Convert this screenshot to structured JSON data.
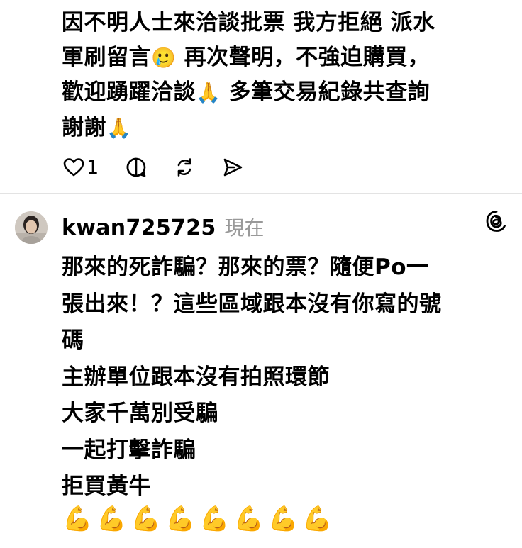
{
  "post": {
    "lines": [
      "因不明人士來洽談批票 我方拒絕 派水",
      "軍刷留言",
      "再次聲明，不強迫購買，",
      "歡迎踴躍洽談",
      "多筆交易紀錄共查詢",
      "謝謝"
    ],
    "emoji_tear_smile": "🥲",
    "emoji_pray": "🙏"
  },
  "actions": {
    "like_count": "1",
    "icons": [
      "heart-icon",
      "comment-icon",
      "repost-icon",
      "share-icon"
    ]
  },
  "reply": {
    "username": "kwan725725",
    "time": "現在",
    "lines": [
      "那來的死詐騙？那來的票？隨便Po一",
      "張出來！？這些區域跟本沒有你寫的號",
      "碼",
      "主辦單位跟本沒有拍照環節",
      "大家千萬別受騙",
      "一起打擊詐騙",
      "拒買黃牛"
    ],
    "emoji_muscle": [
      "💪",
      "💪",
      "💪",
      "💪",
      "💪",
      "💪",
      "💪",
      "💪"
    ]
  },
  "colors": {
    "text": "#000000",
    "muted": "#999999",
    "divider": "#e3e3e3",
    "icon": "#000000"
  }
}
